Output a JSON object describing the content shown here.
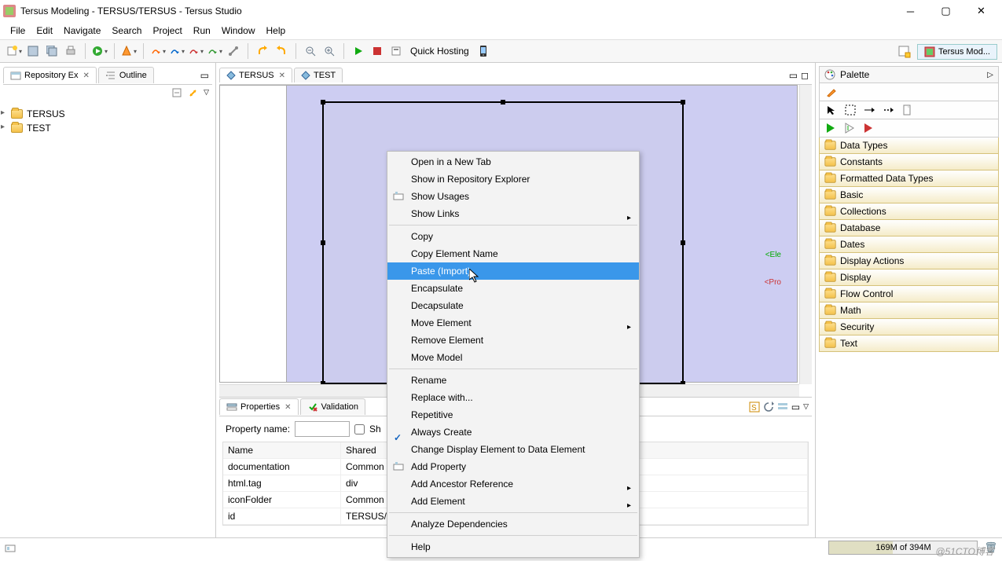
{
  "title": "Tersus Modeling - TERSUS/TERSUS - Tersus Studio",
  "menu": [
    "File",
    "Edit",
    "Navigate",
    "Search",
    "Project",
    "Run",
    "Window",
    "Help"
  ],
  "quick_hosting": "Quick Hosting",
  "perspective_label": "Tersus Mod...",
  "left_tabs": {
    "repo": "Repository Ex",
    "outline": "Outline"
  },
  "tree_items": [
    "TERSUS",
    "TEST"
  ],
  "editor_tabs": [
    "TERSUS",
    "TEST"
  ],
  "canvas_right_labels": [
    "<Ele",
    "<Pro"
  ],
  "bottom_tabs": {
    "props": "Properties",
    "valid": "Validation"
  },
  "prop_form": {
    "label": "Property name:",
    "checkbox": "Sh"
  },
  "prop_table": {
    "headers": [
      "Name",
      "Shared"
    ],
    "rows": [
      [
        "documentation",
        "Common"
      ],
      [
        "html.tag",
        "div"
      ],
      [
        "iconFolder",
        "Common"
      ],
      [
        "id",
        "TERSUS/"
      ]
    ]
  },
  "palette": {
    "title": "Palette",
    "drawers": [
      "Data Types",
      "Constants",
      "Formatted Data Types",
      "Basic",
      "Collections",
      "Database",
      "Dates",
      "Display Actions",
      "Display",
      "Flow Control",
      "Math",
      "Security",
      "Text"
    ]
  },
  "contextmenu": [
    {
      "t": "Open in a New Tab"
    },
    {
      "t": "Show in Repository Explorer"
    },
    {
      "t": "Show Usages",
      "icon": true
    },
    {
      "t": "Show Links",
      "sub": true
    },
    {
      "sep": true
    },
    {
      "t": "Copy"
    },
    {
      "t": "Copy Element Name"
    },
    {
      "t": "Paste (Import)",
      "hl": true
    },
    {
      "t": "Encapsulate"
    },
    {
      "t": "Decapsulate"
    },
    {
      "t": "Move Element",
      "sub": true
    },
    {
      "t": "Remove Element"
    },
    {
      "t": "Move Model"
    },
    {
      "sep": true
    },
    {
      "t": "Rename"
    },
    {
      "t": "Replace with..."
    },
    {
      "t": "Repetitive"
    },
    {
      "t": "Always Create",
      "check": true
    },
    {
      "t": "Change Display Element to Data Element"
    },
    {
      "t": "Add Property",
      "icon": true
    },
    {
      "t": "Add Ancestor Reference",
      "sub": true
    },
    {
      "t": "Add Element",
      "sub": true
    },
    {
      "sep": true
    },
    {
      "t": "Analyze Dependencies"
    },
    {
      "sep": true
    },
    {
      "t": "Help"
    }
  ],
  "status": {
    "heap": "169M of 394M"
  },
  "watermark": "@51CTO博客"
}
